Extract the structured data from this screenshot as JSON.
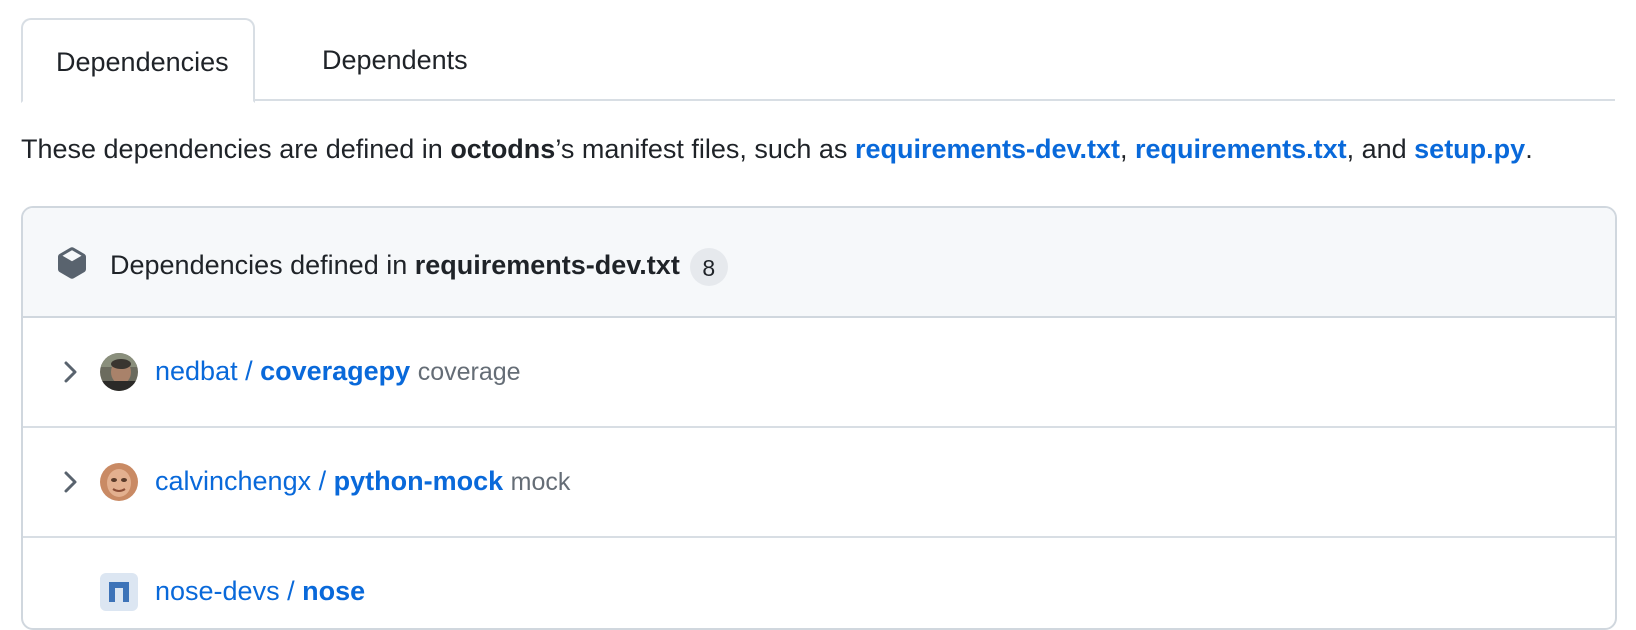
{
  "tabs": [
    {
      "label": "Dependencies",
      "active": true
    },
    {
      "label": "Dependents",
      "active": false
    }
  ],
  "intro": {
    "prefix": "These dependencies are defined in ",
    "repo": "octodns",
    "middle": "’s manifest files, such as ",
    "file1": "requirements-dev.txt",
    "comma1": ", ",
    "file2": "requirements.txt",
    "and": ", and ",
    "file3": "setup.py",
    "end": "."
  },
  "section": {
    "label_prefix": "Dependencies defined in ",
    "file": "requirements-dev.txt",
    "count": "8",
    "icon": "package-icon"
  },
  "dependencies": [
    {
      "owner": "nedbat",
      "separator": " / ",
      "repo": "coveragepy",
      "package": "coverage",
      "avatar_icon": "avatar-photo"
    },
    {
      "owner": "calvinchengx",
      "separator": " / ",
      "repo": "python-mock",
      "package": "mock",
      "avatar_icon": "avatar-photo"
    },
    {
      "owner": "nose-devs",
      "separator": " / ",
      "repo": "nose",
      "package": "",
      "avatar_icon": "avatar-org"
    }
  ],
  "colors": {
    "link": "#0969da",
    "muted": "#656d76",
    "border": "#d0d7de",
    "header_bg": "#f6f8fa"
  }
}
